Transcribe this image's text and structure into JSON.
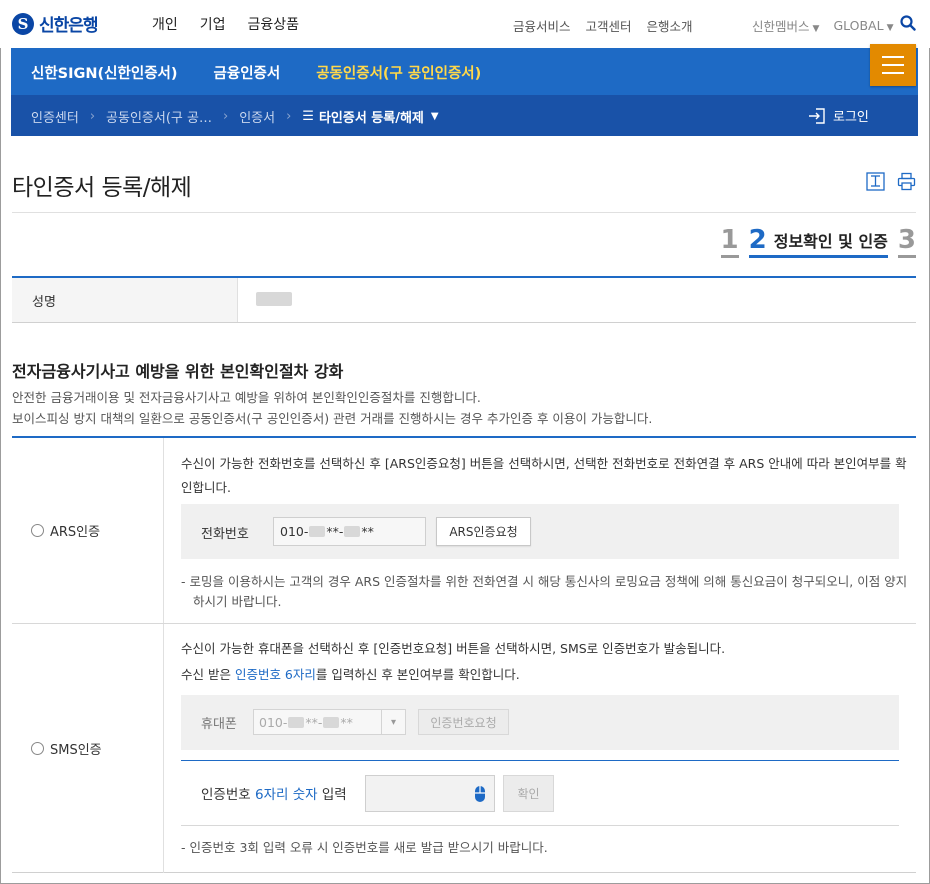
{
  "header": {
    "logo_text": "신한은행",
    "main_menu": [
      "개인",
      "기업",
      "금융상품"
    ],
    "util_menu": [
      "금융서비스",
      "고객센터",
      "은행소개"
    ],
    "members_label": "신한멤버스",
    "global_label": "GLOBAL"
  },
  "nav": {
    "items": [
      "신한SIGN(신한인증서)",
      "금융인증서",
      "공동인증서(구 공인인증서)"
    ],
    "active_index": 2,
    "active_color": "#ffd84a",
    "bg_color": "#1e6ac5",
    "menu_button_color": "#e38a00"
  },
  "breadcrumb": {
    "items": [
      "인증센터",
      "공동인증서(구 공…",
      "인증서"
    ],
    "current": "타인증서 등록/해제",
    "login_label": "로그인"
  },
  "page": {
    "title": "타인증서 등록/해제"
  },
  "steps": {
    "step1": "1",
    "step2": "2",
    "step2_label": "정보확인 및 인증",
    "step3": "3"
  },
  "identity": {
    "name_label": "성명"
  },
  "section": {
    "title": "전자금융사기사고 예방을 위한 본인확인절차 강화",
    "desc1": "안전한 금융거래이용 및 전자금융사기사고 예방을 위하여 본인확인인증절차를 진행합니다.",
    "desc2": "보이스피싱 방지 대책의 일환으로 공동인증서(구 공인인증서) 관련 거래를 진행하시는 경우 추가인증 후 이용이 가능합니다."
  },
  "ars": {
    "label": "ARS인증",
    "desc1": "수신이 가능한 전화번호를 선택하신 후 [ARS인증요청] 버튼을 선택하시면, 선택한 전화번호로 전화연결 후 ARS 안내에 따라 본인여부를 확",
    "desc2": "인합니다.",
    "phone_label": "전화번호",
    "phone_prefix": "010-",
    "phone_mid": "**-",
    "phone_end": "**",
    "button": "ARS인증요청",
    "note1": "-  로밍을 이용하시는 고객의 경우 ARS 인증절차를 위한 전화연결 시 해당 통신사의 로밍요금 정책에 의해 통신요금이 청구되오니, 이점 양지",
    "note2": "하시기 바랍니다."
  },
  "sms": {
    "label": "SMS인증",
    "desc1": "수신이 가능한 휴대폰을 선택하신 후 [인증번호요청] 버튼을 선택하시면, SMS로 인증번호가 발송됩니다.",
    "desc2_pre": "수신 받은 ",
    "desc2_blue": "인증번호 6자리",
    "desc2_post": "를 입력하신 후 본인여부를 확인합니다.",
    "phone_label": "휴대폰",
    "phone_prefix": "010-",
    "phone_mid": "**-",
    "phone_end": "**",
    "request_button": "인증번호요청",
    "code_label_pre": "인증번호 ",
    "code_label_blue": "6자리 숫자",
    "code_label_post": " 입력",
    "confirm_button": "확인",
    "note": "-  인증번호 3회 입력 오류 시 인증번호를 새로 발급 받으시기 바랍니다."
  }
}
